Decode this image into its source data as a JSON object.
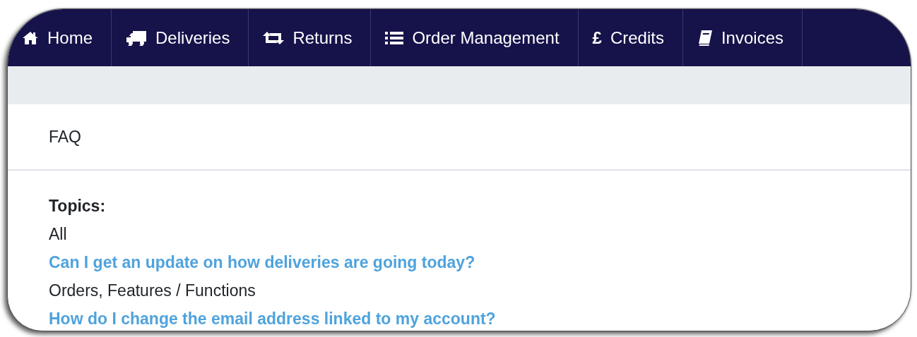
{
  "nav": [
    {
      "label": "Home"
    },
    {
      "label": "Deliveries"
    },
    {
      "label": "Returns"
    },
    {
      "label": "Order Management"
    },
    {
      "label": "Credits",
      "symbol": "£"
    },
    {
      "label": "Invoices"
    }
  ],
  "page_title": "FAQ",
  "topics_heading": "Topics:",
  "entries": [
    {
      "kind": "topic",
      "text": "All"
    },
    {
      "kind": "question",
      "text": "Can I get an update on how deliveries are going today?"
    },
    {
      "kind": "topic",
      "text": "Orders, Features / Functions"
    },
    {
      "kind": "question",
      "text": "How do I change the email address linked to my account?"
    }
  ]
}
